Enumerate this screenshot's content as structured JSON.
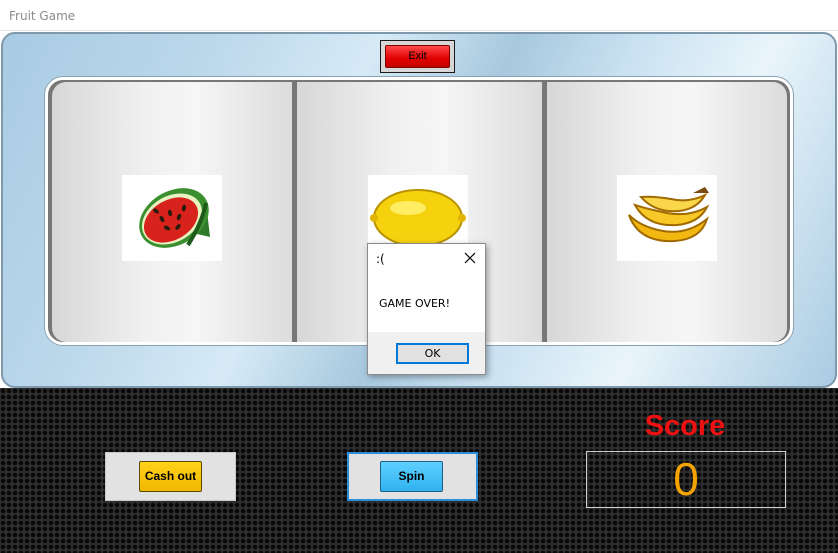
{
  "window": {
    "title": "Fruit Game"
  },
  "machine": {
    "exit_label": "Exit",
    "reels": [
      {
        "icon": "watermelon-icon"
      },
      {
        "icon": "lemon-icon"
      },
      {
        "icon": "banana-icon"
      }
    ]
  },
  "controls": {
    "cash_out_label": "Cash out",
    "spin_label": "Spin"
  },
  "score": {
    "label": "Score",
    "value": "0"
  },
  "dialog": {
    "title": ":(",
    "message": "GAME OVER!",
    "ok_label": "OK"
  },
  "colors": {
    "exit_button": "#e00000",
    "cash_out_button": "#f1b800",
    "spin_button": "#2fb2ef",
    "score_label": "#ee1111",
    "score_value": "#f5a300",
    "dialog_focus": "#0078d7"
  }
}
